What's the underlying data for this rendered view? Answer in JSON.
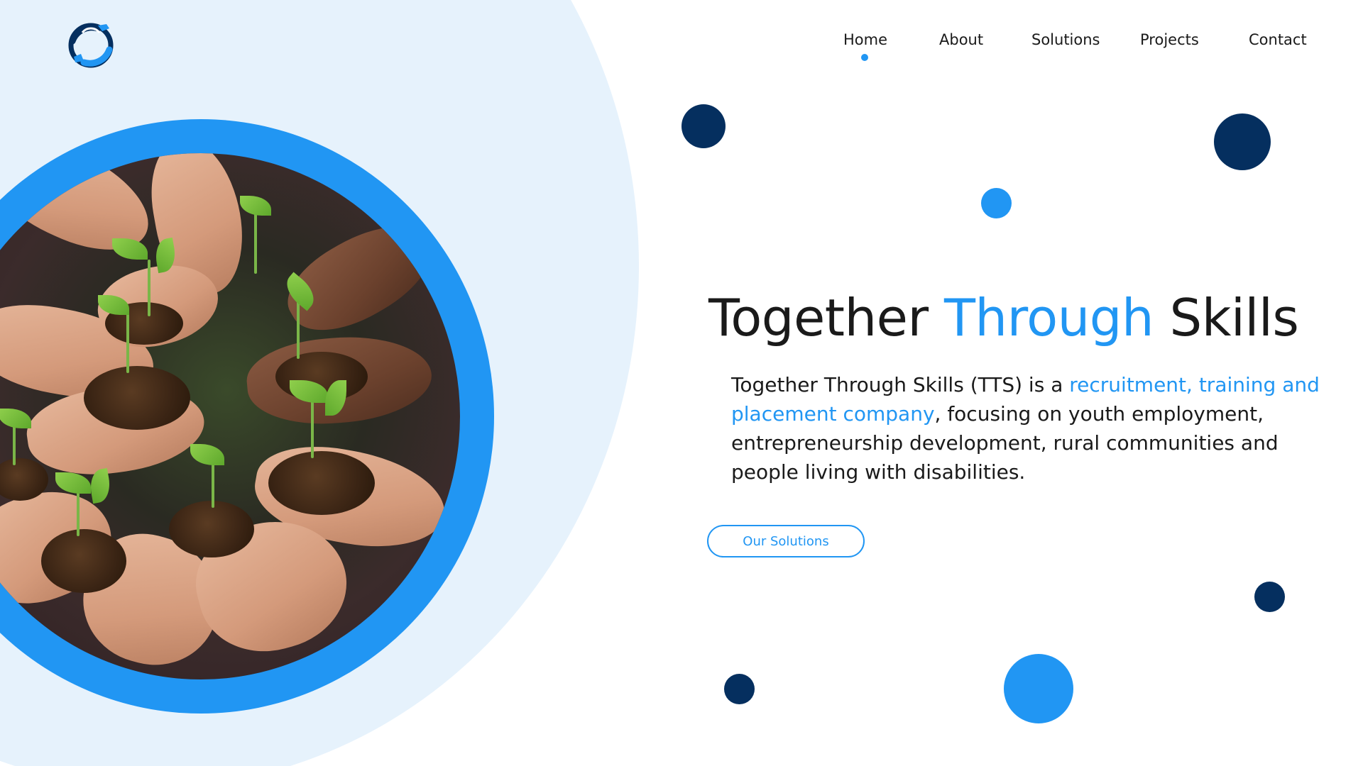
{
  "brand": {
    "logo_icon": "hands-circle-logo-icon",
    "colors": {
      "accent": "#2196f3",
      "navy": "#052f5f",
      "backdrop": "#e6f2fc",
      "text": "#1a1a1a"
    }
  },
  "nav": {
    "items": [
      {
        "label": "Home",
        "active": true
      },
      {
        "label": "About",
        "active": false
      },
      {
        "label": "Solutions",
        "active": false
      },
      {
        "label": "Projects",
        "active": false
      },
      {
        "label": "Contact",
        "active": false
      }
    ]
  },
  "hero": {
    "title_part1": "Together ",
    "title_accent": "Through",
    "title_part2": " Skills",
    "body_part1": "Together Through Skills (TTS) is a ",
    "body_accent": "recruitment, training and placement company",
    "body_part2": ", focusing on youth employment, entrepreneurship development, rural communities and people living with disabilities.",
    "cta_label": "Our Solutions",
    "image_subject": "hands-holding-seedlings-photo"
  }
}
